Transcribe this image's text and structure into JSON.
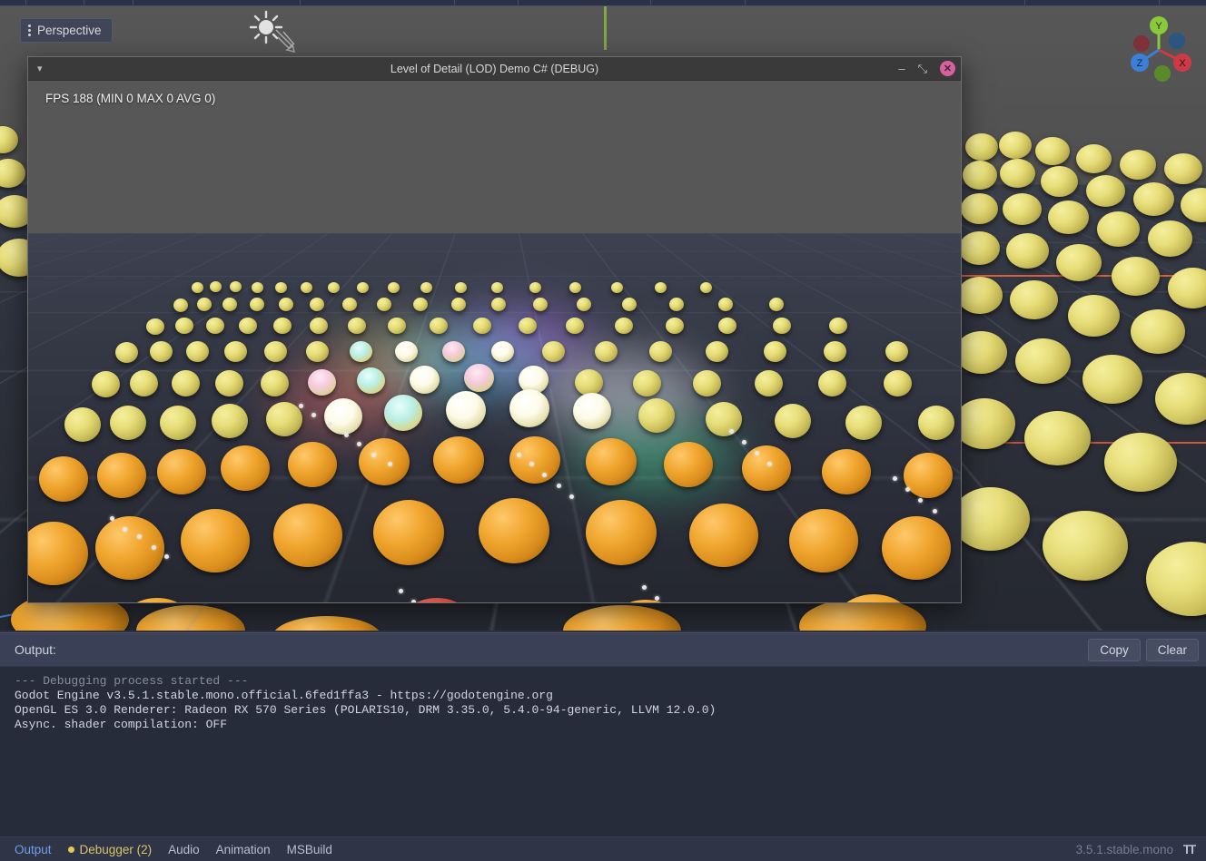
{
  "editor": {
    "viewport": {
      "perspective_label": "Perspective",
      "menu_icon": "three-dots-vertical-icon",
      "light_gizmo_icon": "directional-light-icon",
      "axis_gizmo": {
        "x_label": "X",
        "y_label": "Y",
        "z_label": "Z",
        "x_color": "#cc3b45",
        "y_color": "#8ac93a",
        "z_color": "#3b7fd6"
      },
      "axis_line_colors": {
        "x": "#d4593c",
        "y": "#8aad45",
        "z": "#3f7fd4"
      }
    },
    "dock": {
      "title": "Output:",
      "copy_label": "Copy",
      "clear_label": "Clear",
      "log_lines": [
        {
          "text": "--- Debugging process started ---",
          "dim": true
        },
        {
          "text": "Godot Engine v3.5.1.stable.mono.official.6fed1ffa3 - https://godotengine.org",
          "dim": false
        },
        {
          "text": "OpenGL ES 3.0 Renderer: Radeon RX 570 Series (POLARIS10, DRM 3.35.0, 5.4.0-94-generic, LLVM 12.0.0)",
          "dim": false
        },
        {
          "text": "Async. shader compilation: OFF",
          "dim": false
        }
      ]
    },
    "statusbar": {
      "tabs": [
        {
          "label": "Output",
          "state": "active",
          "dot": false
        },
        {
          "label": "Debugger (2)",
          "state": "warn",
          "dot": true
        },
        {
          "label": "Audio",
          "state": "normal",
          "dot": false
        },
        {
          "label": "Animation",
          "state": "normal",
          "dot": false
        },
        {
          "label": "MSBuild",
          "state": "normal",
          "dot": false
        }
      ],
      "version": "3.5.1.stable.mono",
      "grip_icon": "resize-grip-icon"
    }
  },
  "game_window": {
    "title": "Level of Detail (LOD) Demo C# (DEBUG)",
    "chevron_icon": "chevron-down-icon",
    "minimize_label": "–",
    "maximize_label": "⤡",
    "close_label": "✕",
    "close_color": "#d2639c",
    "fps_overlay": "FPS 188 (MIN 0 MAX 0 AVG 0)"
  }
}
